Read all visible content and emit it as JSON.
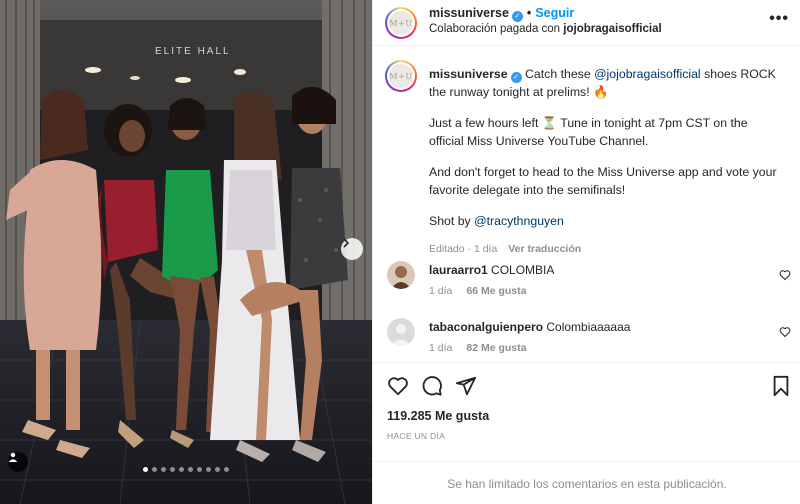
{
  "post": {
    "dots_count": 10,
    "active_dot": 0,
    "venue_sign": "ELITE HALL"
  },
  "header": {
    "username": "missuniverse",
    "follow_label": "Seguir",
    "separator": "•",
    "collab_prefix": "Colaboración pagada con",
    "collab_partner": "jojobragaisofficial",
    "more_icon": "more-horizontal-icon",
    "avatar_text": "M+U"
  },
  "caption": {
    "username": "missuniverse",
    "line1_pre": "Catch these",
    "mention": "@jojobragaisofficial",
    "line1_post": "shoes ROCK the runway tonight at prelims! 🔥",
    "para2": "Just a few hours left ⏳ Tune in tonight at 7pm CST on the official Miss Universe YouTube Channel.",
    "para3": "And don't forget to head to the Miss Universe app and vote your favorite delegate into the semifinals!",
    "shot_by_label": "Shot by",
    "shot_by_mention": "@tracythnguyen",
    "edited": "Editado · 1 día",
    "see_translation": "Ver traducción"
  },
  "comments": [
    {
      "user": "lauraarro1",
      "text": "COLOMBIA",
      "time": "1 día",
      "likes": "66 Me gusta"
    },
    {
      "user": "tabaconalguienpero",
      "text": "Colombiaaaaaa",
      "time": "1 día",
      "likes": "82 Me gusta"
    }
  ],
  "actions": {
    "likes": "119.285 Me gusta",
    "time_ago": "HACE UN DÍA",
    "comments_limited": "Se han limitado los comentarios en esta publicación."
  },
  "colors": {
    "link": "#00376b",
    "follow": "#0095f6",
    "muted": "#8e8e8e",
    "verified": "#3897f0"
  }
}
